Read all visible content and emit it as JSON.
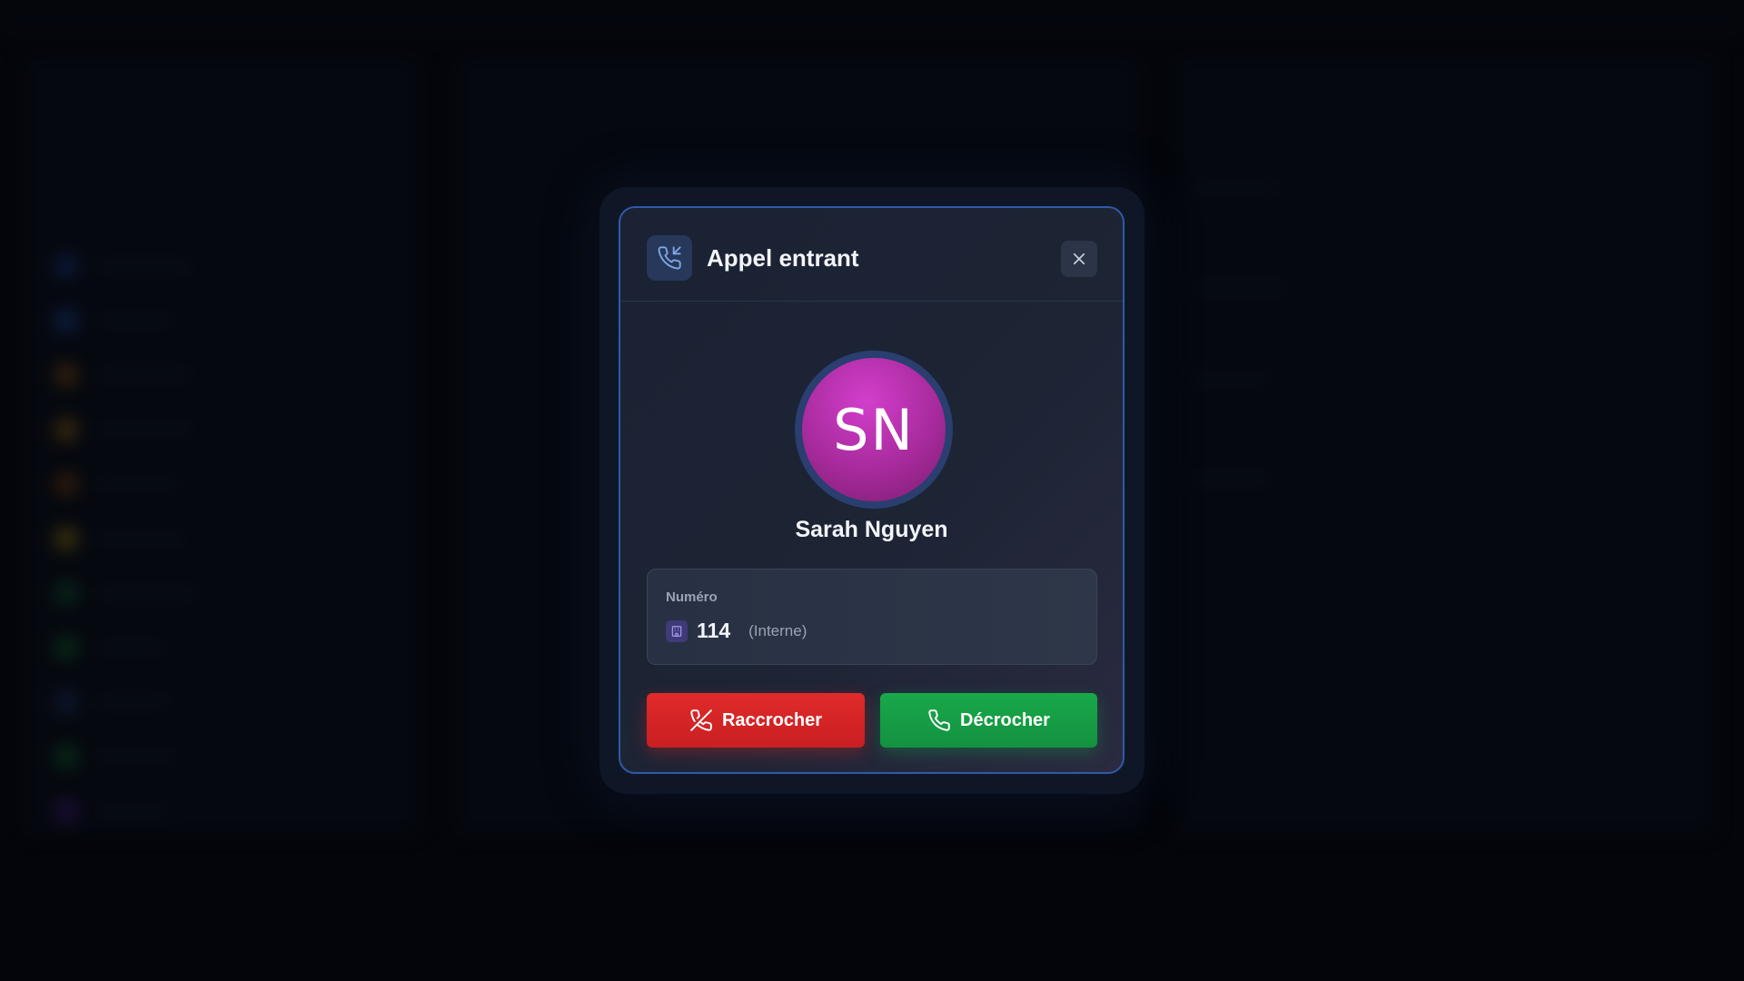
{
  "modal": {
    "title": "Appel entrant",
    "caller": {
      "initials": "SN",
      "name": "Sarah Nguyen"
    },
    "number": {
      "label": "Numéro",
      "value": "114",
      "type": "(Interne)"
    },
    "buttons": {
      "hangup_label": "Raccrocher",
      "answer_label": "Décrocher"
    }
  },
  "icons": {
    "header": "incoming-call-icon",
    "close": "close-icon",
    "extension": "building-icon",
    "hangup": "phone-off-icon",
    "answer": "phone-icon"
  },
  "colors": {
    "accent_border": "#2f5aa8",
    "avatar": "#b02fa5",
    "hangup": "#dc2626",
    "answer": "#16a34a"
  }
}
